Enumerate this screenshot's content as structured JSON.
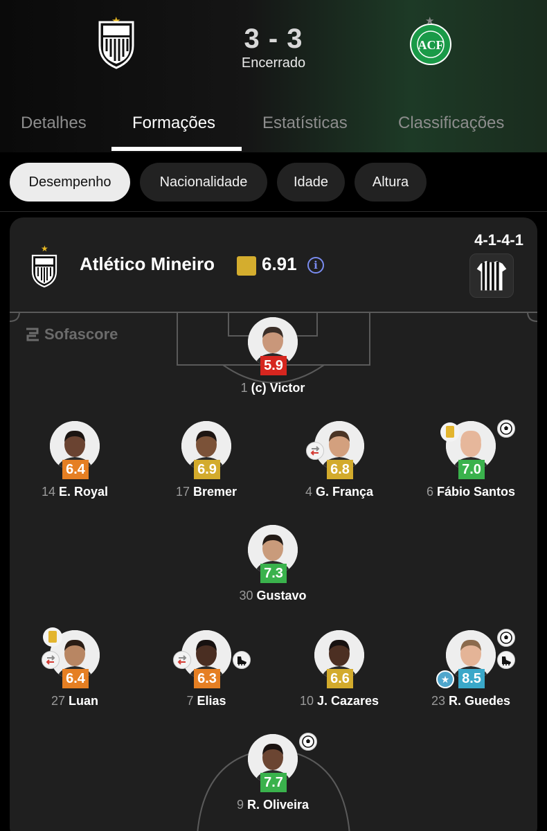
{
  "match": {
    "score": "3 - 3",
    "status": "Encerrado",
    "home_crest_text": "C A M",
    "away_crest_text": "ACF"
  },
  "tabs": [
    {
      "label": "Detalhes"
    },
    {
      "label": "Formações"
    },
    {
      "label": "Estatísticas"
    },
    {
      "label": "Classificações"
    }
  ],
  "chips": [
    {
      "label": "Desempenho"
    },
    {
      "label": "Nacionalidade"
    },
    {
      "label": "Idade"
    },
    {
      "label": "Altura"
    }
  ],
  "team": {
    "name": "Atlético Mineiro",
    "rating": "6.91",
    "formation": "4-1-4-1"
  },
  "watermark": "Sofascore",
  "colors": {
    "rating_red": "#d6261f",
    "rating_orange": "#e57f23",
    "rating_yellow": "#d3ab2c",
    "rating_green": "#3ab24c",
    "rating_blue": "#3aa8c9",
    "yellow_card": "#e3b52e",
    "brand_gold": "#e8b923"
  },
  "players": [
    {
      "number": "1",
      "name": "(c) Victor",
      "rating": "5.9",
      "rating_color": "red",
      "skin": "#c9977a",
      "hair": "#3a2e28"
    },
    {
      "number": "14",
      "name": "E. Royal",
      "rating": "6.4",
      "rating_color": "orange",
      "skin": "#6a4331",
      "hair": "#1b1411"
    },
    {
      "number": "17",
      "name": "Bremer",
      "rating": "6.9",
      "rating_color": "yellow",
      "skin": "#7b5238",
      "hair": "#1d1512"
    },
    {
      "number": "4",
      "name": "G. França",
      "rating": "6.8",
      "rating_color": "yellow",
      "skin": "#d3a07e",
      "hair": "#4b3424"
    },
    {
      "number": "6",
      "name": "Fábio Santos",
      "rating": "7.0",
      "rating_color": "green",
      "skin": "#e6b79b",
      "hair": "#e6b79b"
    },
    {
      "number": "30",
      "name": "Gustavo",
      "rating": "7.3",
      "rating_color": "green",
      "skin": "#c99b7b",
      "hair": "#221a15"
    },
    {
      "number": "27",
      "name": "Luan",
      "rating": "6.4",
      "rating_color": "orange",
      "skin": "#b88663",
      "hair": "#2a1d15"
    },
    {
      "number": "7",
      "name": "Elias",
      "rating": "6.3",
      "rating_color": "orange",
      "skin": "#4a2e22",
      "hair": "#171110"
    },
    {
      "number": "10",
      "name": "J. Cazares",
      "rating": "6.6",
      "rating_color": "yellow",
      "skin": "#4c2f22",
      "hair": "#171110"
    },
    {
      "number": "23",
      "name": "R. Guedes",
      "rating": "8.5",
      "rating_color": "blue",
      "skin": "#e4b497",
      "hair": "#8b6a4c"
    },
    {
      "number": "9",
      "name": "R. Oliveira",
      "rating": "7.7",
      "rating_color": "green",
      "skin": "#6b4532",
      "hair": "#1a1311"
    }
  ],
  "icons": {
    "yellow_card": "yellow-card-icon",
    "substitution": "substitution-icon",
    "goal": "goal-ball-icon",
    "assist": "assist-boot-icon",
    "player_of_match": "star-icon",
    "info": "info-icon"
  }
}
